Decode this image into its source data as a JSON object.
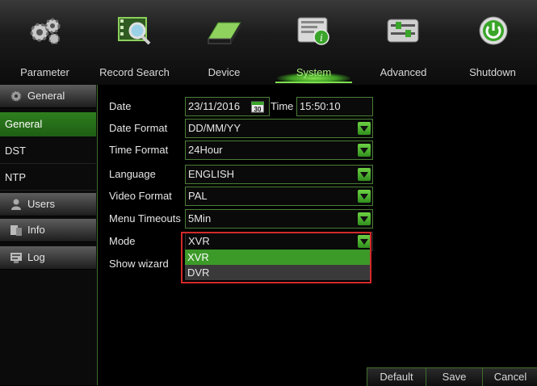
{
  "tabs": [
    {
      "label": "Parameter",
      "icon": "gears-icon"
    },
    {
      "label": "Record Search",
      "icon": "film-search-icon"
    },
    {
      "label": "Device",
      "icon": "hdd-icon"
    },
    {
      "label": "System",
      "icon": "system-info-icon",
      "active": true
    },
    {
      "label": "Advanced",
      "icon": "advanced-icon"
    },
    {
      "label": "Shutdown",
      "icon": "power-icon"
    }
  ],
  "sidebar": {
    "general_header": "General",
    "items": [
      "General",
      "DST",
      "NTP"
    ],
    "users": "Users",
    "info": "Info",
    "log": "Log"
  },
  "form": {
    "date_label": "Date",
    "date_value": "23/11/2016",
    "calendar_day": "30",
    "time_label": "Time",
    "time_value": "15:50:10",
    "date_format_label": "Date Format",
    "date_format_value": "DD/MM/YY",
    "time_format_label": "Time Format",
    "time_format_value": "24Hour",
    "language_label": "Language",
    "language_value": "ENGLISH",
    "video_format_label": "Video Format",
    "video_format_value": "PAL",
    "menu_timeouts_label": "Menu Timeouts",
    "menu_timeouts_value": "5Min",
    "mode_label": "Mode",
    "mode_value": "XVR",
    "mode_options": [
      "XVR",
      "DVR"
    ],
    "show_wizard_label": "Show wizard"
  },
  "buttons": {
    "default": "Default",
    "save": "Save",
    "cancel": "Cancel"
  },
  "colors": {
    "accent_green": "#2e8a1e",
    "highlight_red": "#d22a2a"
  }
}
